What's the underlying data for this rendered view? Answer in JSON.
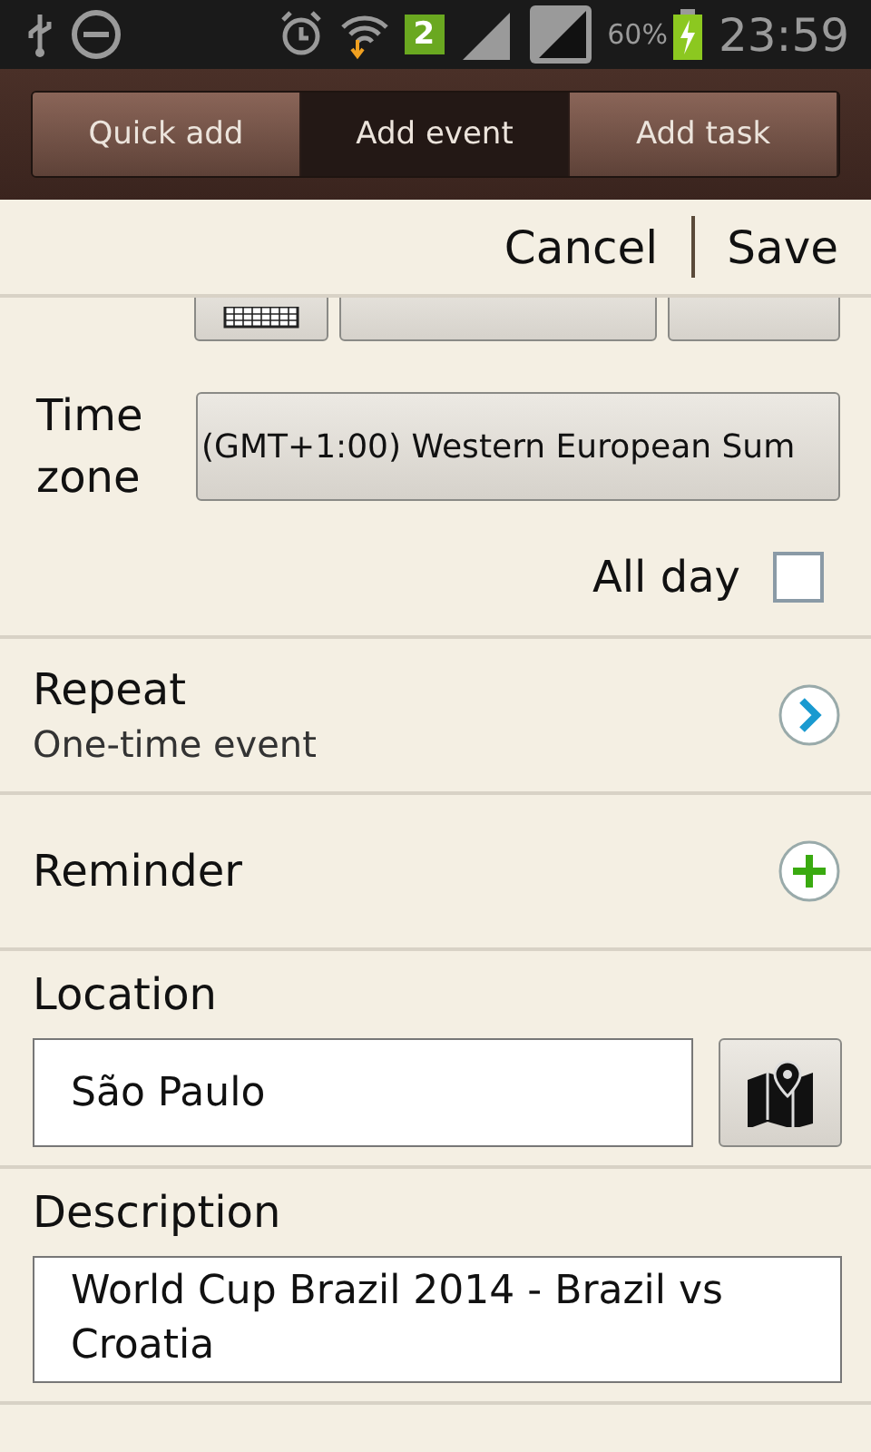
{
  "status_bar": {
    "sim_badge": "2",
    "battery_percent": "60%",
    "time": "23:59"
  },
  "tabs": [
    {
      "label": "Quick add",
      "selected": false
    },
    {
      "label": "Add event",
      "selected": true
    },
    {
      "label": "Add task",
      "selected": false
    }
  ],
  "actions": {
    "cancel": "Cancel",
    "save": "Save"
  },
  "time_zone": {
    "label_line_1": "Time",
    "label_line_2": "zone",
    "value": "(GMT+1:00) Western European Sum"
  },
  "all_day": {
    "label": "All day",
    "checked": false
  },
  "repeat": {
    "label": "Repeat",
    "value": "One-time event"
  },
  "reminder": {
    "label": "Reminder"
  },
  "location": {
    "label": "Location",
    "value": "São Paulo"
  },
  "description": {
    "label": "Description",
    "value": "World Cup Brazil 2014 - Brazil vs Croatia"
  }
}
